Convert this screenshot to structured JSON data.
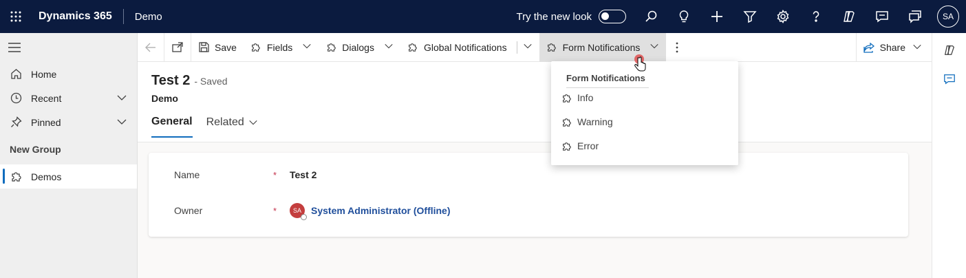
{
  "topbar": {
    "brand": "Dynamics 365",
    "app_name": "Demo",
    "try_new_look": "Try the new look",
    "avatar_initials": "SA",
    "icons": [
      "waffle-icon",
      "search-icon",
      "lightbulb-icon",
      "plus-icon",
      "filter-icon",
      "settings-icon",
      "help-icon",
      "copilot-icon",
      "chat-icon",
      "feedback-icon"
    ]
  },
  "sidebar": {
    "items": [
      {
        "label": "Home",
        "icon": "home-icon"
      },
      {
        "label": "Recent",
        "icon": "clock-icon"
      },
      {
        "label": "Pinned",
        "icon": "pin-icon"
      }
    ],
    "group_title": "New Group",
    "group_items": [
      {
        "label": "Demos",
        "icon": "puzzle-icon",
        "active": true
      }
    ]
  },
  "commandbar": {
    "save": "Save",
    "fields": "Fields",
    "dialogs": "Dialogs",
    "global_notifications": "Global Notifications",
    "form_notifications": "Form Notifications",
    "share": "Share"
  },
  "record": {
    "title": "Test 2",
    "status": "- Saved",
    "entity": "Demo",
    "tabs": [
      "General",
      "Related"
    ]
  },
  "form": {
    "name_label": "Name",
    "name_value": "Test 2",
    "owner_label": "Owner",
    "owner_initials": "SA",
    "owner_value": "System Administrator (Offline)",
    "required_mark": "*"
  },
  "flyout": {
    "title": "Form Notifications",
    "items": [
      "Info",
      "Warning",
      "Error"
    ]
  },
  "colors": {
    "topbar": "#0b1b3f",
    "accent": "#0f6cbd",
    "required": "#c4314b",
    "avatar": "#c43e3e"
  }
}
